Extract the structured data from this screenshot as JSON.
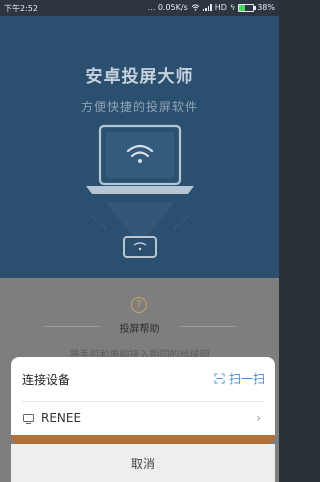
{
  "status_bar": {
    "time": "下午2:52",
    "network_speed": "... 0.05K/s",
    "network_type": "HD",
    "battery_percent": "38%",
    "battery_level": 0.38,
    "battery_color": "#4bd964",
    "icons": [
      "wifi-icon",
      "signal-icon",
      "charging-icon",
      "battery-icon"
    ]
  },
  "hero": {
    "title": "安卓投屏大师",
    "subtitle": "方便快捷的投屏软件",
    "background": "#2b4f6e",
    "icons": [
      "laptop-icon",
      "wifi-icon",
      "phone-icon"
    ]
  },
  "help": {
    "icon": "question-icon",
    "label": "投屏帮助",
    "description": "将手机和电脑接入相同的局域网"
  },
  "device_sheet": {
    "title": "连接设备",
    "scan_label": "扫一扫",
    "scan_icon": "scan-icon",
    "accent": "#3d8fe0",
    "devices": [
      {
        "name": "RENEE",
        "icon": "tv-icon"
      }
    ],
    "cancel_label": "取消"
  }
}
